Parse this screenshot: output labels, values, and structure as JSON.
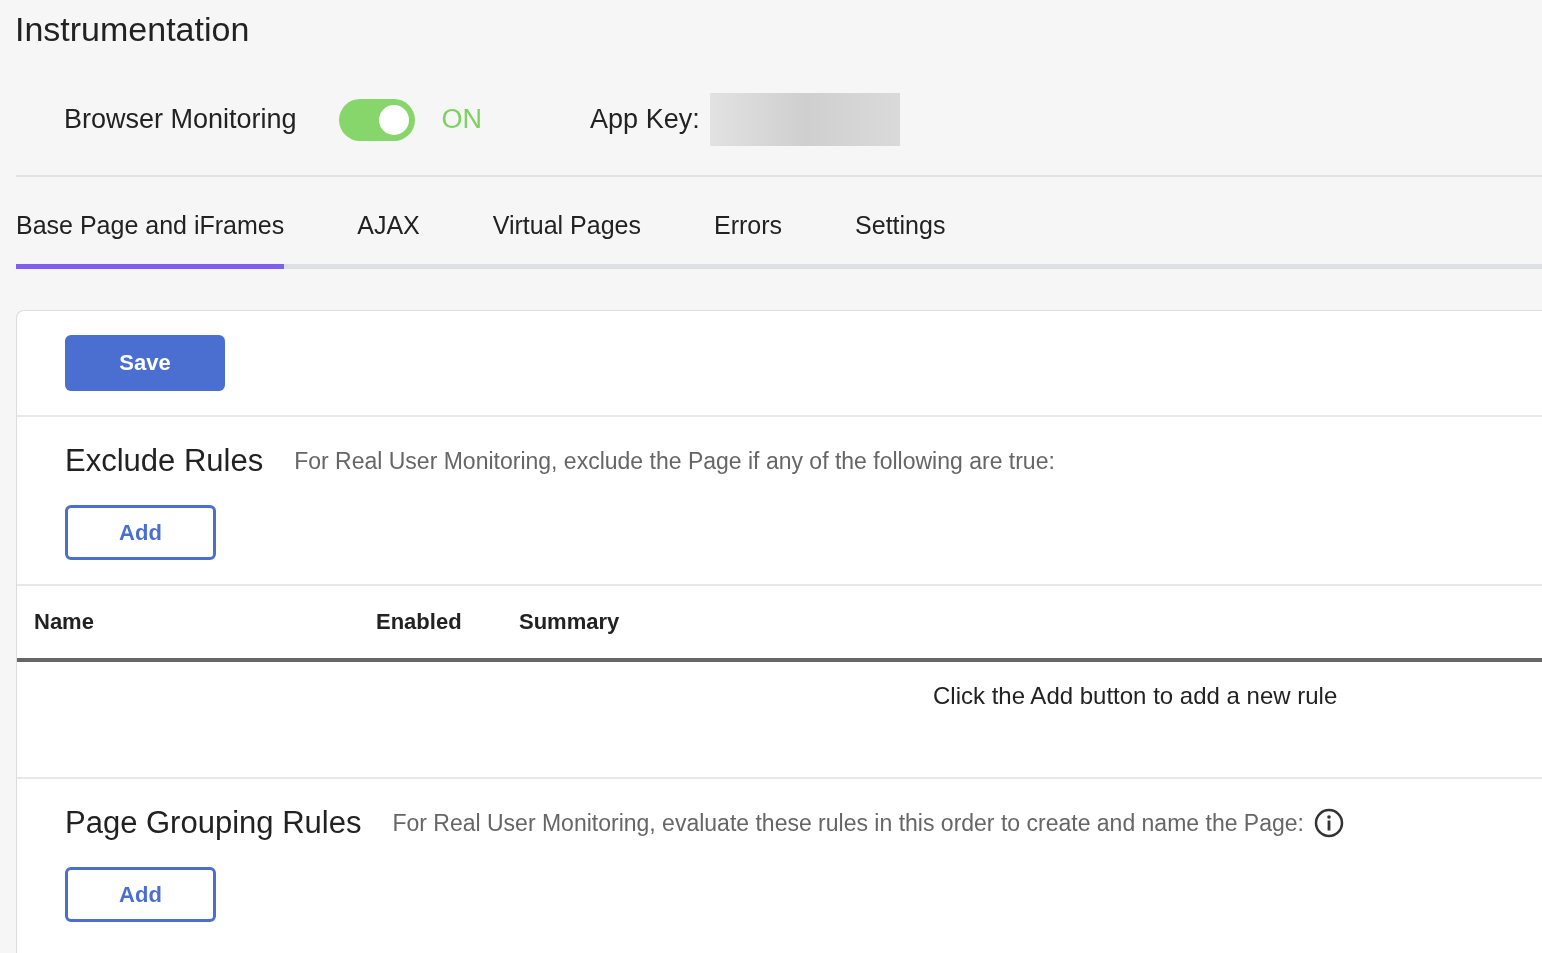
{
  "page": {
    "title": "Instrumentation"
  },
  "monitoring": {
    "label": "Browser Monitoring",
    "on": true,
    "state_text": "ON",
    "app_key_label": "App Key:"
  },
  "tabs": [
    {
      "label": "Base Page and iFrames",
      "selected": true
    },
    {
      "label": "AJAX",
      "selected": false
    },
    {
      "label": "Virtual Pages",
      "selected": false
    },
    {
      "label": "Errors",
      "selected": false
    },
    {
      "label": "Settings",
      "selected": false
    }
  ],
  "save_button": "Save",
  "sections": [
    {
      "title": "Exclude Rules",
      "description": "For Real User Monitoring, exclude the Page if any of the following are true:",
      "info": false,
      "add_button": "Add",
      "table": {
        "columns": [
          "Name",
          "Enabled",
          "Summary"
        ],
        "empty_message": "Click the Add button to add a new rule"
      }
    },
    {
      "title": "Page Grouping Rules",
      "description": "For Real User Monitoring, evaluate these rules in this order to create and name the Page:",
      "info": true,
      "add_button": "Add"
    }
  ]
}
